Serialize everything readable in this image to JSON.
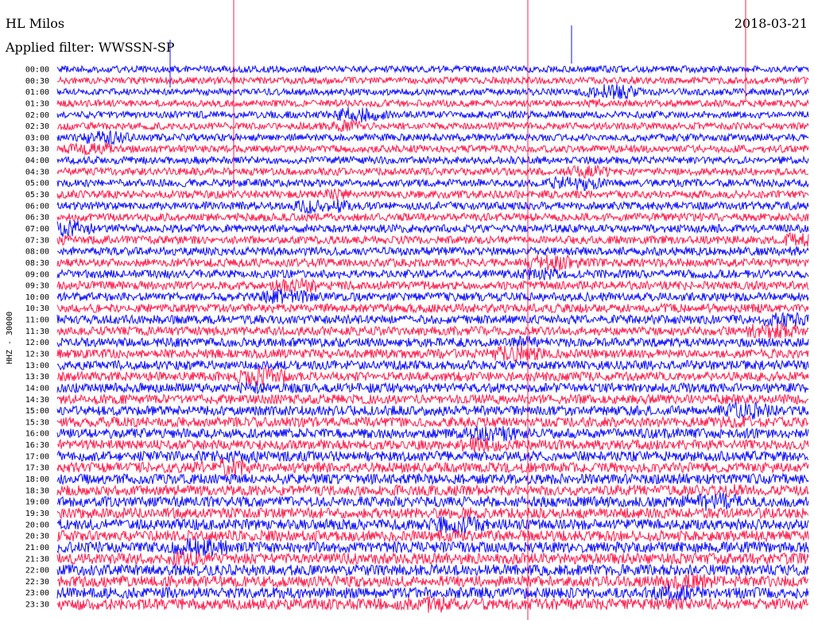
{
  "header": {
    "station": "HL Milos",
    "filter": "Applied filter: WWSSN-SP",
    "date": "2018-03-21"
  },
  "chart_data": {
    "type": "line",
    "title": "HL Milos",
    "subtitle": "Applied filter: WWSSN-SP",
    "date": "2018-03-21",
    "ylabel": "HHZ - 30000",
    "xlabel": "",
    "row_interval_minutes": 30,
    "rows": [
      "00:00",
      "00:30",
      "01:00",
      "01:30",
      "02:00",
      "02:30",
      "03:00",
      "03:30",
      "04:00",
      "04:30",
      "05:00",
      "05:30",
      "06:00",
      "06:30",
      "07:00",
      "07:30",
      "08:00",
      "08:30",
      "09:00",
      "09:30",
      "10:00",
      "10:30",
      "11:00",
      "11:30",
      "12:00",
      "12:30",
      "13:00",
      "13:30",
      "14:00",
      "14:30",
      "15:00",
      "15:30",
      "16:00",
      "16:30",
      "17:00",
      "17:30",
      "18:00",
      "18:30",
      "19:00",
      "19:30",
      "20:00",
      "20:30",
      "21:00",
      "21:30",
      "22:00",
      "22:30",
      "23:00",
      "23:30"
    ],
    "series_colors": [
      "#1010ff",
      "#ff1f4f"
    ],
    "grid": false,
    "legend": "none",
    "notes_visible": "alternating blue/red traces per 30-minute row; recurring vertical spikes near minutes 6, 16 and 25 of rows"
  }
}
